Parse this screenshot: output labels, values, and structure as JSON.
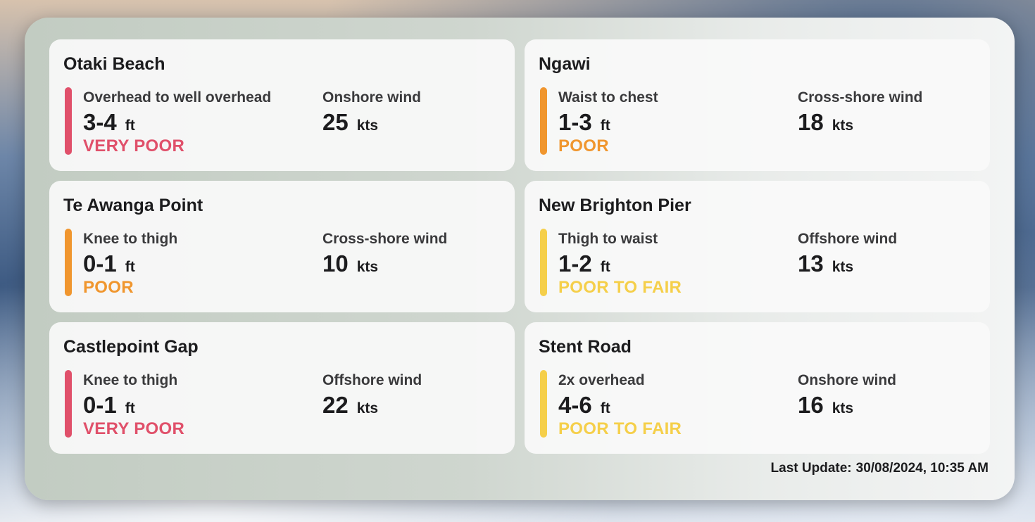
{
  "ratings": {
    "very_poor": {
      "label": "VERY POOR",
      "color": "#e0506a"
    },
    "poor": {
      "label": "POOR",
      "color": "#f0962e"
    },
    "poor_to_fair": {
      "label": "POOR TO FAIR",
      "color": "#f5cf4a"
    }
  },
  "spots": [
    {
      "name": "Otaki Beach",
      "wave_desc": "Overhead to well overhead",
      "wave_height": "3-4",
      "wave_unit": "ft",
      "rating": "VERY POOR",
      "rating_color": "#e0506a",
      "wind_desc": "Onshore wind",
      "wind_speed": "25",
      "wind_unit": "kts"
    },
    {
      "name": "Ngawi",
      "wave_desc": "Waist to chest",
      "wave_height": "1-3",
      "wave_unit": "ft",
      "rating": "POOR",
      "rating_color": "#f0962e",
      "wind_desc": "Cross-shore wind",
      "wind_speed": "18",
      "wind_unit": "kts"
    },
    {
      "name": "Te Awanga Point",
      "wave_desc": "Knee to thigh",
      "wave_height": "0-1",
      "wave_unit": "ft",
      "rating": "POOR",
      "rating_color": "#f0962e",
      "wind_desc": "Cross-shore wind",
      "wind_speed": "10",
      "wind_unit": "kts"
    },
    {
      "name": "New Brighton Pier",
      "wave_desc": "Thigh to waist",
      "wave_height": "1-2",
      "wave_unit": "ft",
      "rating": "POOR TO FAIR",
      "rating_color": "#f5cf4a",
      "wind_desc": "Offshore wind",
      "wind_speed": "13",
      "wind_unit": "kts"
    },
    {
      "name": "Castlepoint Gap",
      "wave_desc": "Knee to thigh",
      "wave_height": "0-1",
      "wave_unit": "ft",
      "rating": "VERY POOR",
      "rating_color": "#e0506a",
      "wind_desc": "Offshore wind",
      "wind_speed": "22",
      "wind_unit": "kts"
    },
    {
      "name": "Stent Road",
      "wave_desc": "2x overhead",
      "wave_height": "4-6",
      "wave_unit": "ft",
      "rating": "POOR TO FAIR",
      "rating_color": "#f5cf4a",
      "wind_desc": "Onshore wind",
      "wind_speed": "16",
      "wind_unit": "kts"
    }
  ],
  "last_update": {
    "label": "Last Update:",
    "value": "30/08/2024, 10:35 AM"
  }
}
